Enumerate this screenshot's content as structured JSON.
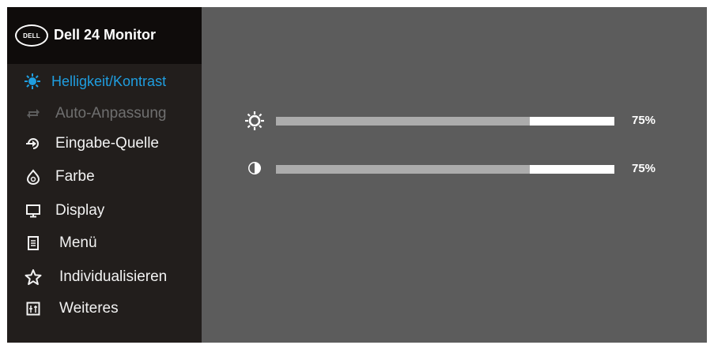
{
  "header": {
    "logo_text": "DELL",
    "title": "Dell 24 Monitor"
  },
  "menu": {
    "items": [
      {
        "label": "Helligkeit/Kontrast",
        "icon": "brightness-contrast-icon",
        "state": "active"
      },
      {
        "label": "Auto-Anpassung",
        "icon": "auto-adjust-icon",
        "state": "disabled"
      },
      {
        "label": "Eingabe-Quelle",
        "icon": "input-source-icon",
        "state": "normal"
      },
      {
        "label": "Farbe",
        "icon": "color-icon",
        "state": "normal"
      },
      {
        "label": "Display",
        "icon": "display-icon",
        "state": "normal"
      },
      {
        "label": "Menü",
        "icon": "menu-icon",
        "state": "normal"
      },
      {
        "label": "Individualisieren",
        "icon": "star-icon",
        "state": "normal"
      },
      {
        "label": "Weiteres",
        "icon": "others-icon",
        "state": "normal"
      }
    ]
  },
  "settings": {
    "brightness": {
      "icon": "sun-icon",
      "value": 75,
      "value_text": "75%"
    },
    "contrast": {
      "icon": "contrast-icon",
      "value": 75,
      "value_text": "75%"
    }
  },
  "colors": {
    "panel_bg": "#5c5c5c",
    "sidebar_bg": "#221e1c",
    "header_bg": "#0f0c0b",
    "active_accent": "#1f9ee0",
    "slider_fill": "#acacac",
    "slider_track": "#ffffff"
  }
}
